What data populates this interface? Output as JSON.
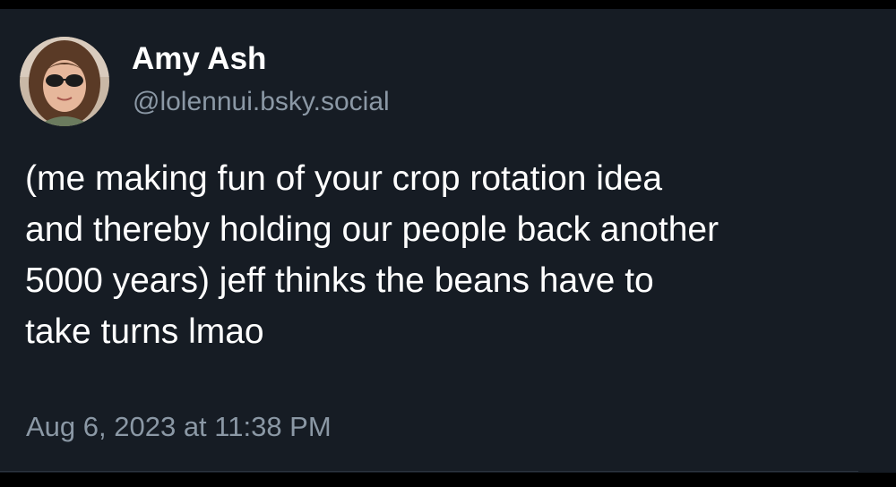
{
  "post": {
    "author": {
      "display_name": "Amy Ash",
      "handle": "@lolennui.bsky.social",
      "avatar_icon": "user-avatar-photo"
    },
    "body_lines": [
      "(me making fun of your crop rotation idea",
      "and thereby holding our people back another",
      "5000 years) jeff thinks the beans have to",
      "take turns lmao"
    ],
    "timestamp": "Aug 6, 2023 at 11:38 PM"
  },
  "colors": {
    "background": "#161c24",
    "primary_text": "#ffffff",
    "secondary_text": "#8b98a5"
  }
}
